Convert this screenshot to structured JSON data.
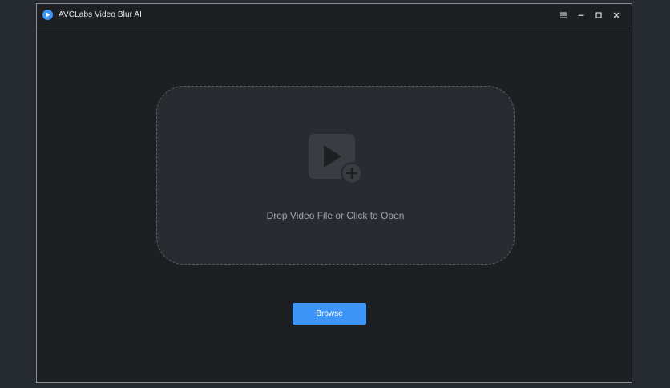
{
  "window": {
    "title": "AVCLabs Video Blur AI"
  },
  "titlebar": {
    "controls": [
      "menu-icon",
      "minimize-icon",
      "maximize-icon",
      "close-icon"
    ]
  },
  "drop_zone": {
    "icon": "video-add-icon",
    "text": "Drop Video File or Click to Open"
  },
  "browse": {
    "label": "Browse"
  },
  "colors": {
    "background": "#262a31",
    "window": "#1e1f23",
    "drop_zone": "#2a2b30",
    "accent": "#3d96f7",
    "text_muted": "#9ea2aa"
  }
}
